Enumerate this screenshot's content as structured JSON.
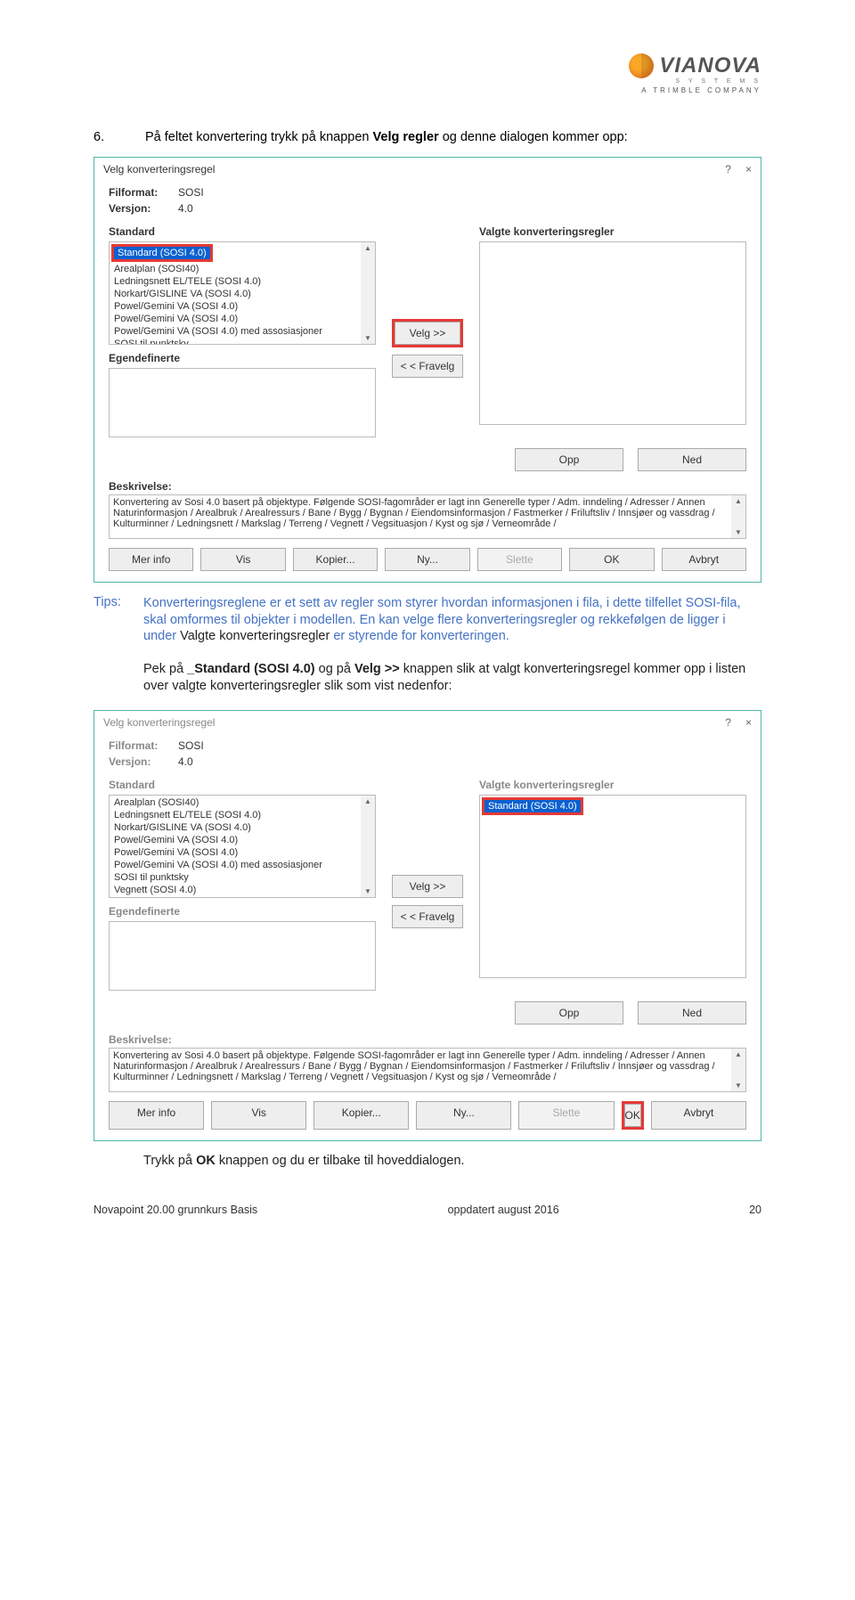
{
  "header": {
    "brand": "VIANOVA",
    "tag": "A  TRIMBLE  COMPANY",
    "sys": "S Y S T E M S"
  },
  "sec6": {
    "num": "6.",
    "text_a": "På feltet konvertering trykk på knappen ",
    "text_b": "Velg regler",
    "text_c": " og denne dialogen kommer opp:"
  },
  "dlg": {
    "title": "Velg konverteringsregel",
    "help": "?",
    "close": "×",
    "filformat_l": "Filformat:",
    "filformat_v": "SOSI",
    "versjon_l": "Versjon:",
    "versjon_v": "4.0",
    "standard_h": "Standard",
    "valgte_h": "Valgte konverteringsregler",
    "egend_h": "Egendefinerte",
    "velg_btn": "Velg >>",
    "fravelg_btn": "< < Fravelg",
    "opp_btn": "Opp",
    "ned_btn": "Ned",
    "beskriv_h": "Beskrivelse:",
    "beskriv_t": "Konvertering av Sosi 4.0 basert på objektype. Følgende SOSI-fagområder er lagt inn Generelle typer / Adm. inndeling / Adresser / Annen Naturinformasjon / Arealbruk / Arealressurs / Bane / Bygg / Bygnan / Eiendomsinformasjon / Fastmerker / Friluftsliv / Innsjøer og vassdrag / Kulturminner / Ledningsnett / Markslag / Terreng / Vegnett / Vegsituasjon / Kyst og sjø / Verneområde /",
    "b_merinfo": "Mer info",
    "b_vis": "Vis",
    "b_kopier": "Kopier...",
    "b_ny": "Ny...",
    "b_slette": "Slette",
    "b_ok": "OK",
    "b_avbryt": "Avbryt"
  },
  "list1": [
    "Standard (SOSI 4.0)",
    "Arealplan (SOSI40)",
    "Ledningsnett EL/TELE (SOSI 4.0)",
    "Norkart/GISLINE VA (SOSI 4.0)",
    "Powel/Gemini VA (SOSI 4.0)",
    "Powel/Gemini VA (SOSI 4.0)",
    "Powel/Gemini VA (SOSI 4.0) med assosiasjoner",
    "SOSI til punktsky"
  ],
  "list2": [
    "Arealplan (SOSI40)",
    "Ledningsnett EL/TELE (SOSI 4.0)",
    "Norkart/GISLINE VA (SOSI 4.0)",
    "Powel/Gemini VA (SOSI 4.0)",
    "Powel/Gemini VA (SOSI 4.0)",
    "Powel/Gemini VA (SOSI 4.0) med assosiasjoner",
    "SOSI til punktsky",
    "Vegnett (SOSI 4.0)"
  ],
  "list2_sel": "Standard (SOSI 4.0)",
  "tips1": {
    "lbl": "Tips:",
    "t1": "Konverteringsreglene er et sett av regler som styrer hvordan informasjonen i fila, i dette tilfellet SOSI-fila, skal omformes til objekter i modellen. En kan velge flere konverteringsregler og rekkefølgen de ligger i under ",
    "t2": "Valgte konverteringsregler",
    "t3": " er styrende for konverteringen."
  },
  "tips2": {
    "t1": "Pek på ",
    "t2": "_Standard (SOSI 4.0)",
    "t3": " og på ",
    "t4": "Velg >>",
    "t5": " knappen slik at valgt konverteringsregel kommer opp i listen over valgte konverteringsregler slik som vist nedenfor:"
  },
  "after": {
    "t1": "Trykk på ",
    "t2": "OK",
    "t3": " knappen og du er tilbake til hoveddialogen."
  },
  "footer": {
    "left": "Novapoint 20.00 grunnkurs Basis",
    "mid": "oppdatert august 2016",
    "right": "20"
  }
}
